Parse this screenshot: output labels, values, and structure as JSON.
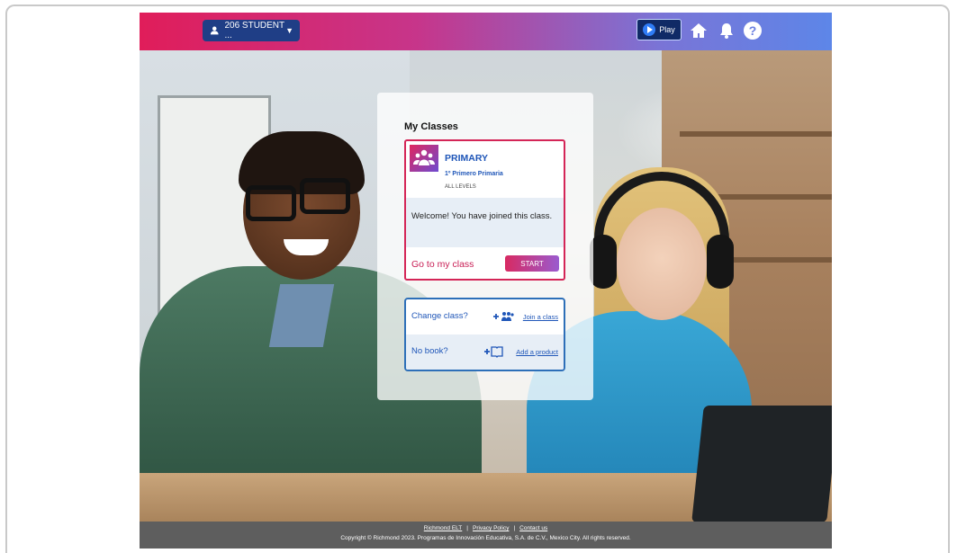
{
  "header": {
    "user_label": "206 STUDENT ...",
    "play_label": "Play",
    "colors": {
      "gradient_start": "#e01d5a",
      "gradient_end": "#5d86e8",
      "user_button": "#1f3e86"
    }
  },
  "panel": {
    "title": "My Classes",
    "class_card": {
      "name": "PRIMARY",
      "subtitle": "1º Primero Primaria",
      "level": "ALL LEVELS",
      "welcome": "Welcome! You have joined this class.",
      "goto_label": "Go to my class",
      "start_label": "START"
    },
    "change_card": {
      "change_label": "Change class?",
      "join_label": "Join a class",
      "nobook_label": "No book?",
      "add_label": "Add a product"
    }
  },
  "footer": {
    "links": [
      "Richmond ELT",
      "Privacy Policy",
      "Contact us"
    ],
    "separator": "|",
    "copyright": "Copyright © Richmond 2023. Programas de Innovación Educativa, S.A. de C.V., Mexico City. All rights reserved."
  }
}
